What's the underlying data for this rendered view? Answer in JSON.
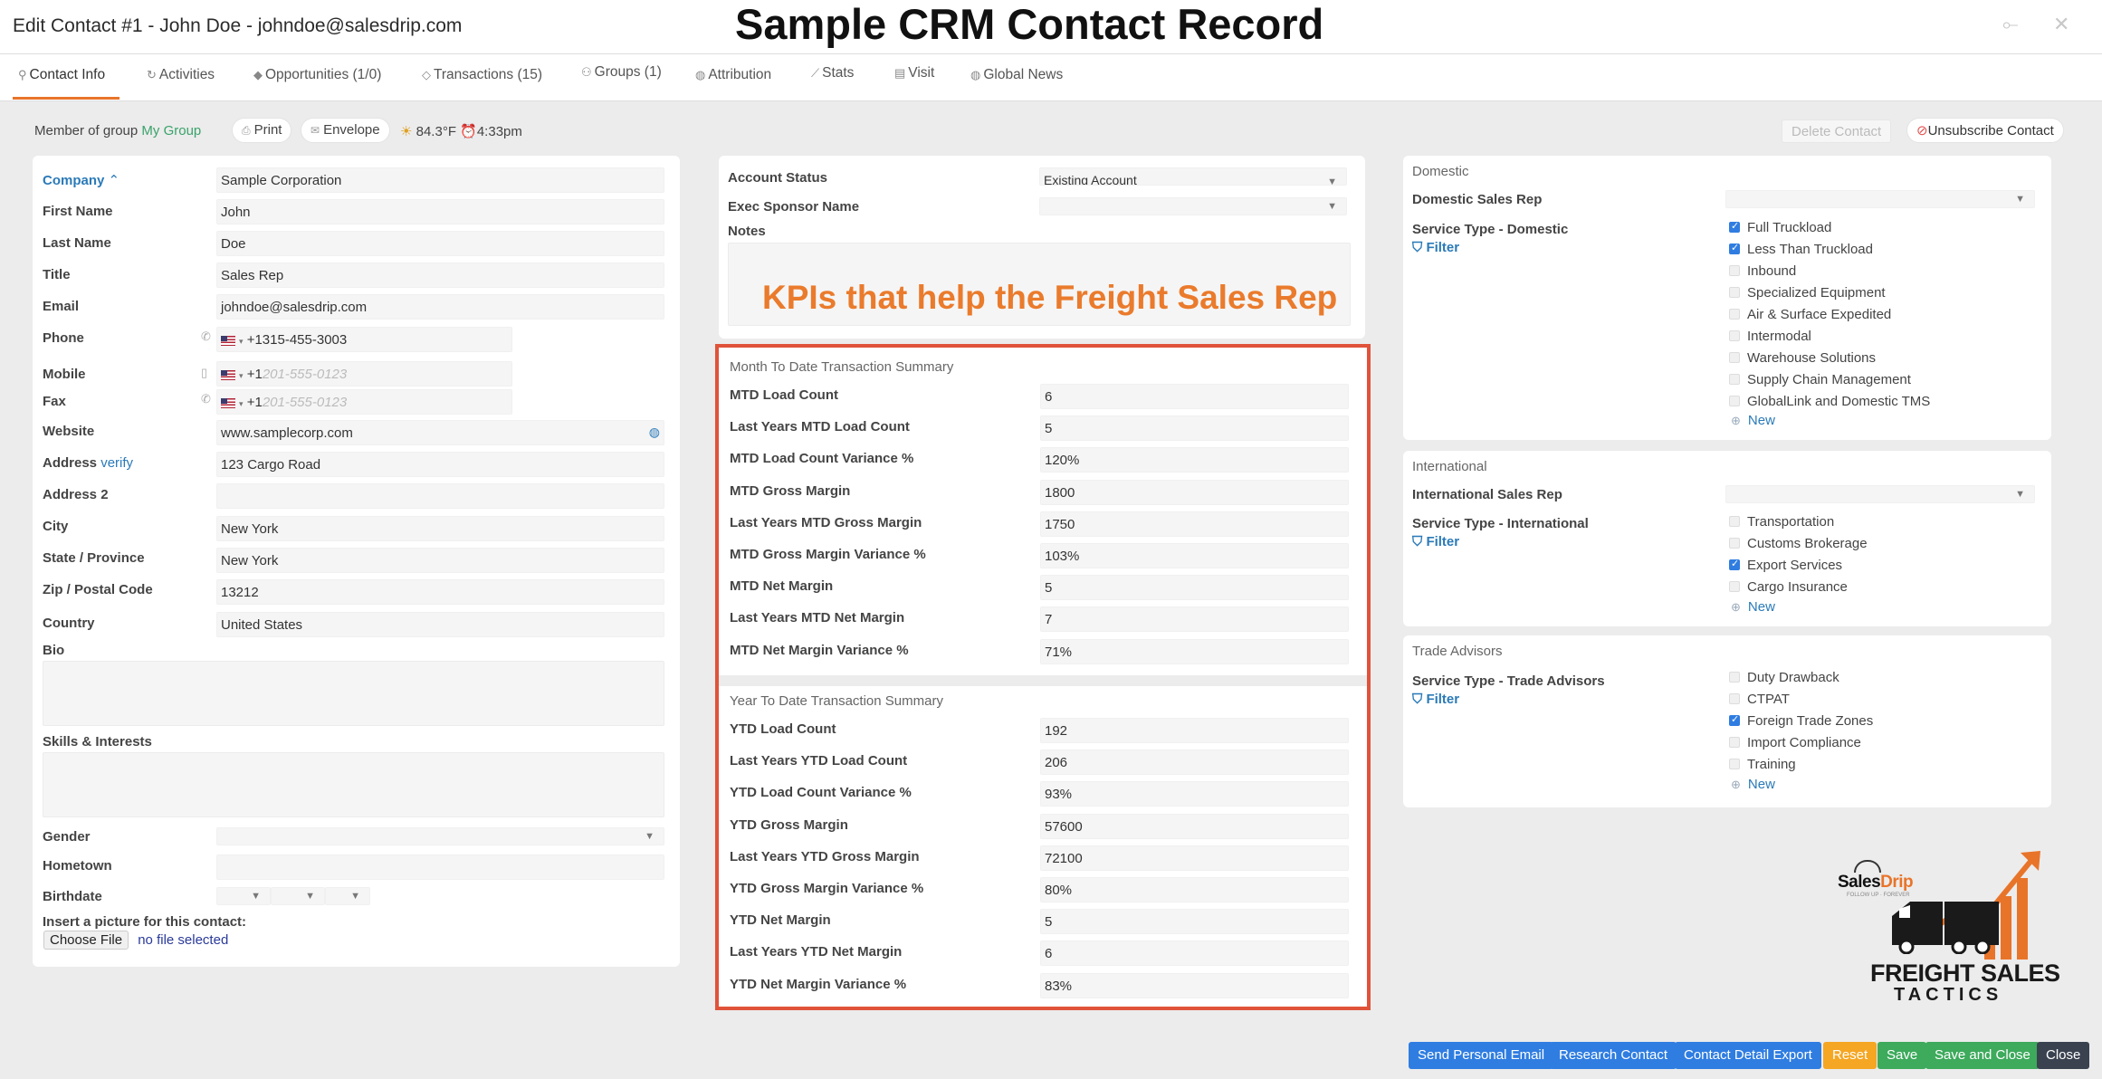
{
  "window": {
    "title": "Edit Contact #1 - John Doe - johndoe@salesdrip.com",
    "banner": "Sample CRM Contact Record"
  },
  "tabs": [
    {
      "label": "Contact Info",
      "icon": "user-icon"
    },
    {
      "label": "Activities",
      "icon": "refresh-icon"
    },
    {
      "label": "Opportunities (1/0)",
      "icon": "diamond-icon"
    },
    {
      "label": "Transactions (15)",
      "icon": "layers-icon"
    },
    {
      "label": "Groups (1)",
      "icon": "group-icon"
    },
    {
      "label": "Attribution",
      "icon": "globe-icon"
    },
    {
      "label": "Stats",
      "icon": "chart-icon"
    },
    {
      "label": "Visit",
      "icon": "document-icon"
    },
    {
      "label": "Global News",
      "icon": "globe-icon"
    }
  ],
  "toolbar": {
    "member_prefix": "Member of group",
    "group": "My Group",
    "print": "Print",
    "envelope": "Envelope",
    "temp": "84.3°F",
    "time": "4:33pm",
    "delete": "Delete Contact",
    "unsubscribe": "Unsubscribe Contact"
  },
  "contact": {
    "company_label": "Company",
    "company": "Sample Corporation",
    "first_name_label": "First Name",
    "first_name": "John",
    "last_name_label": "Last Name",
    "last_name": "Doe",
    "title_label": "Title",
    "title": "Sales Rep",
    "email_label": "Email",
    "email": "johndoe@salesdrip.com",
    "phone_label": "Phone",
    "phone": "+1315-455-3003",
    "mobile_label": "Mobile",
    "mobile_code": "+1",
    "mobile_placeholder": "201-555-0123",
    "fax_label": "Fax",
    "fax_code": "+1",
    "fax_placeholder": "201-555-0123",
    "website_label": "Website",
    "website": "www.samplecorp.com",
    "address_label": "Address",
    "address_verify": "verify",
    "address": "123 Cargo Road",
    "address2_label": "Address 2",
    "address2": "",
    "city_label": "City",
    "city": "New York",
    "state_label": "State / Province",
    "state": "New York",
    "zip_label": "Zip / Postal Code",
    "zip": "13212",
    "country_label": "Country",
    "country": "United States",
    "bio_label": "Bio",
    "skills_label": "Skills & Interests",
    "gender_label": "Gender",
    "hometown_label": "Hometown",
    "birthdate_label": "Birthdate",
    "picture_label": "Insert a picture for this contact:",
    "choose_file": "Choose File",
    "no_file": "no file selected"
  },
  "account": {
    "status_label": "Account Status",
    "status": "Existing Account",
    "exec_label": "Exec Sponsor Name",
    "notes_label": "Notes",
    "kpi_banner": "KPIs that help the Freight Sales Rep"
  },
  "mtd": {
    "title": "Month To Date Transaction Summary",
    "rows": [
      {
        "label": "MTD Load Count",
        "value": "6"
      },
      {
        "label": "Last Years MTD Load Count",
        "value": "5"
      },
      {
        "label": "MTD Load Count Variance %",
        "value": "120%"
      },
      {
        "label": "MTD Gross Margin",
        "value": "1800"
      },
      {
        "label": "Last Years MTD Gross Margin",
        "value": "1750"
      },
      {
        "label": "MTD Gross Margin Variance %",
        "value": "103%"
      },
      {
        "label": "MTD Net Margin",
        "value": "5"
      },
      {
        "label": "Last Years MTD Net Margin",
        "value": "7"
      },
      {
        "label": "MTD Net Margin Variance %",
        "value": "71%"
      }
    ]
  },
  "ytd": {
    "title": "Year To Date Transaction Summary",
    "rows": [
      {
        "label": "YTD Load Count",
        "value": "192"
      },
      {
        "label": "Last Years YTD Load Count",
        "value": "206"
      },
      {
        "label": "YTD Load Count Variance %",
        "value": "93%"
      },
      {
        "label": "YTD Gross Margin",
        "value": "57600"
      },
      {
        "label": "Last Years YTD Gross Margin",
        "value": "72100"
      },
      {
        "label": "YTD Gross Margin Variance %",
        "value": "80%"
      },
      {
        "label": "YTD Net Margin",
        "value": "5"
      },
      {
        "label": "Last Years YTD Net Margin",
        "value": "6"
      },
      {
        "label": "YTD Net Margin Variance %",
        "value": "83%"
      }
    ]
  },
  "domestic": {
    "title": "Domestic",
    "rep_label": "Domestic Sales Rep",
    "service_label": "Service Type - Domestic",
    "filter": "Filter",
    "new": "New",
    "options": [
      {
        "label": "Full Truckload",
        "checked": true
      },
      {
        "label": "Less Than Truckload",
        "checked": true
      },
      {
        "label": "Inbound",
        "checked": false
      },
      {
        "label": "Specialized Equipment",
        "checked": false
      },
      {
        "label": "Air & Surface Expedited",
        "checked": false
      },
      {
        "label": "Intermodal",
        "checked": false
      },
      {
        "label": "Warehouse Solutions",
        "checked": false
      },
      {
        "label": "Supply Chain Management",
        "checked": false
      },
      {
        "label": "GlobalLink and Domestic TMS",
        "checked": false
      }
    ]
  },
  "international": {
    "title": "International",
    "rep_label": "International Sales Rep",
    "service_label": "Service Type - International",
    "filter": "Filter",
    "new": "New",
    "options": [
      {
        "label": "Transportation",
        "checked": false
      },
      {
        "label": "Customs Brokerage",
        "checked": false
      },
      {
        "label": "Export Services",
        "checked": true
      },
      {
        "label": "Cargo Insurance",
        "checked": false
      }
    ]
  },
  "trade": {
    "title": "Trade Advisors",
    "service_label": "Service Type - Trade Advisors",
    "filter": "Filter",
    "new": "New",
    "options": [
      {
        "label": "Duty Drawback",
        "checked": false
      },
      {
        "label": "CTPAT",
        "checked": false
      },
      {
        "label": "Foreign Trade Zones",
        "checked": true
      },
      {
        "label": "Import Compliance",
        "checked": false
      },
      {
        "label": "Training",
        "checked": false
      }
    ]
  },
  "logo": {
    "brand": "SalesDrip",
    "brand_sales": "Sales",
    "brand_drip": "Drip",
    "tagline": "FOLLOW UP · FOREVER",
    "line1": "FREIGHT SALES",
    "line2": "TACTICS"
  },
  "footer": {
    "send_email": "Send Personal Email",
    "research": "Research Contact",
    "export": "Contact Detail Export",
    "reset": "Reset",
    "save": "Save",
    "save_close": "Save and Close",
    "close": "Close"
  },
  "colors": {
    "accent_orange": "#e8742a",
    "kpi_border": "#e0533a",
    "link_blue": "#2a7ab8",
    "btn_blue": "#2f7de1",
    "btn_orange": "#f5a623",
    "btn_green": "#3daa5c",
    "btn_dark": "#3a4250"
  }
}
